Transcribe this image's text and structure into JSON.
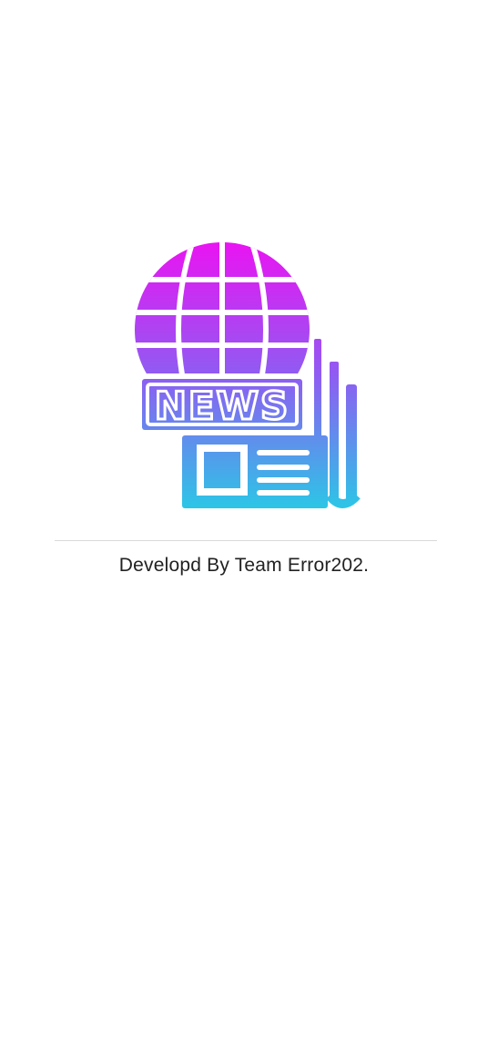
{
  "splash": {
    "logo_icon": "news-globe-newspaper-icon",
    "logo_text": "NEWS",
    "credit_text": "Developd By Team Error202.",
    "gradient": {
      "top": "#e81cf0",
      "middle": "#8e57f0",
      "bottom": "#2fc4e8"
    }
  }
}
